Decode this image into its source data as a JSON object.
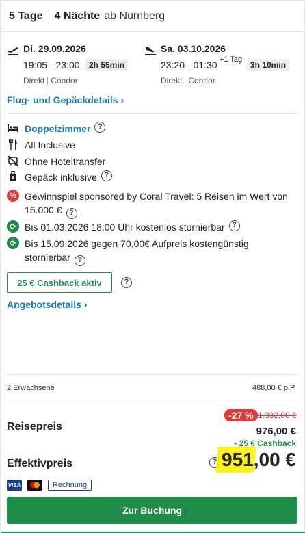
{
  "header": {
    "days": "5 Tage",
    "nights": "4 Nächte",
    "from": "ab Nürnberg"
  },
  "outbound": {
    "date": "Di. 29.09.2026",
    "times": "19:05 - 23:00",
    "duration": "2h 55min",
    "type": "Direkt",
    "airline": "Condor"
  },
  "return": {
    "date": "Sa. 03.10.2026",
    "times": "23:20 - 01:30",
    "plus_day": "+1 Tag",
    "duration": "3h 10min",
    "type": "Direkt",
    "airline": "Condor"
  },
  "flight_details_link": "Flug- und Gepäckdetails",
  "features": {
    "room": "Doppelzimmer",
    "board": "All Inclusive",
    "transfer": "Ohne Hoteltransfer",
    "luggage": "Gepäck inklusive",
    "raffle_line1": "Gewinnspiel sponsored by Coral Travel: 5 Reisen im Wert von",
    "raffle_line2": "15.000 €",
    "cancel1": "Bis 01.03.2026 18:00 Uhr kostenlos stornierbar",
    "cancel2_line1": "Bis 15.09.2026 gegen 70,00€ Aufpreis kostengünstig",
    "cancel2_line2": "stornierbar"
  },
  "cashback_badge": "25 € Cashback aktiv",
  "offer_details_link": "Angebotsdetails",
  "travellers": {
    "label": "2 Erwachsene",
    "per_person": "488,00 € p.P."
  },
  "pricing": {
    "reisepreis_label": "Reisepreis",
    "discount": "-27 %",
    "old_price": "1.332,00 €",
    "price": "976,00 €",
    "cashback": "- 25 € Cashback",
    "effektiv_label": "Effektivpreis",
    "effektiv_price": "951,00 €"
  },
  "payment": {
    "visa": "VISA",
    "invoice": "Rechnung"
  },
  "cta": "Zur Buchung",
  "colors": {
    "accent_blue": "#1e7fb5",
    "green": "#1f8c4a",
    "red": "#e0393a",
    "highlight": "#fff21a"
  }
}
